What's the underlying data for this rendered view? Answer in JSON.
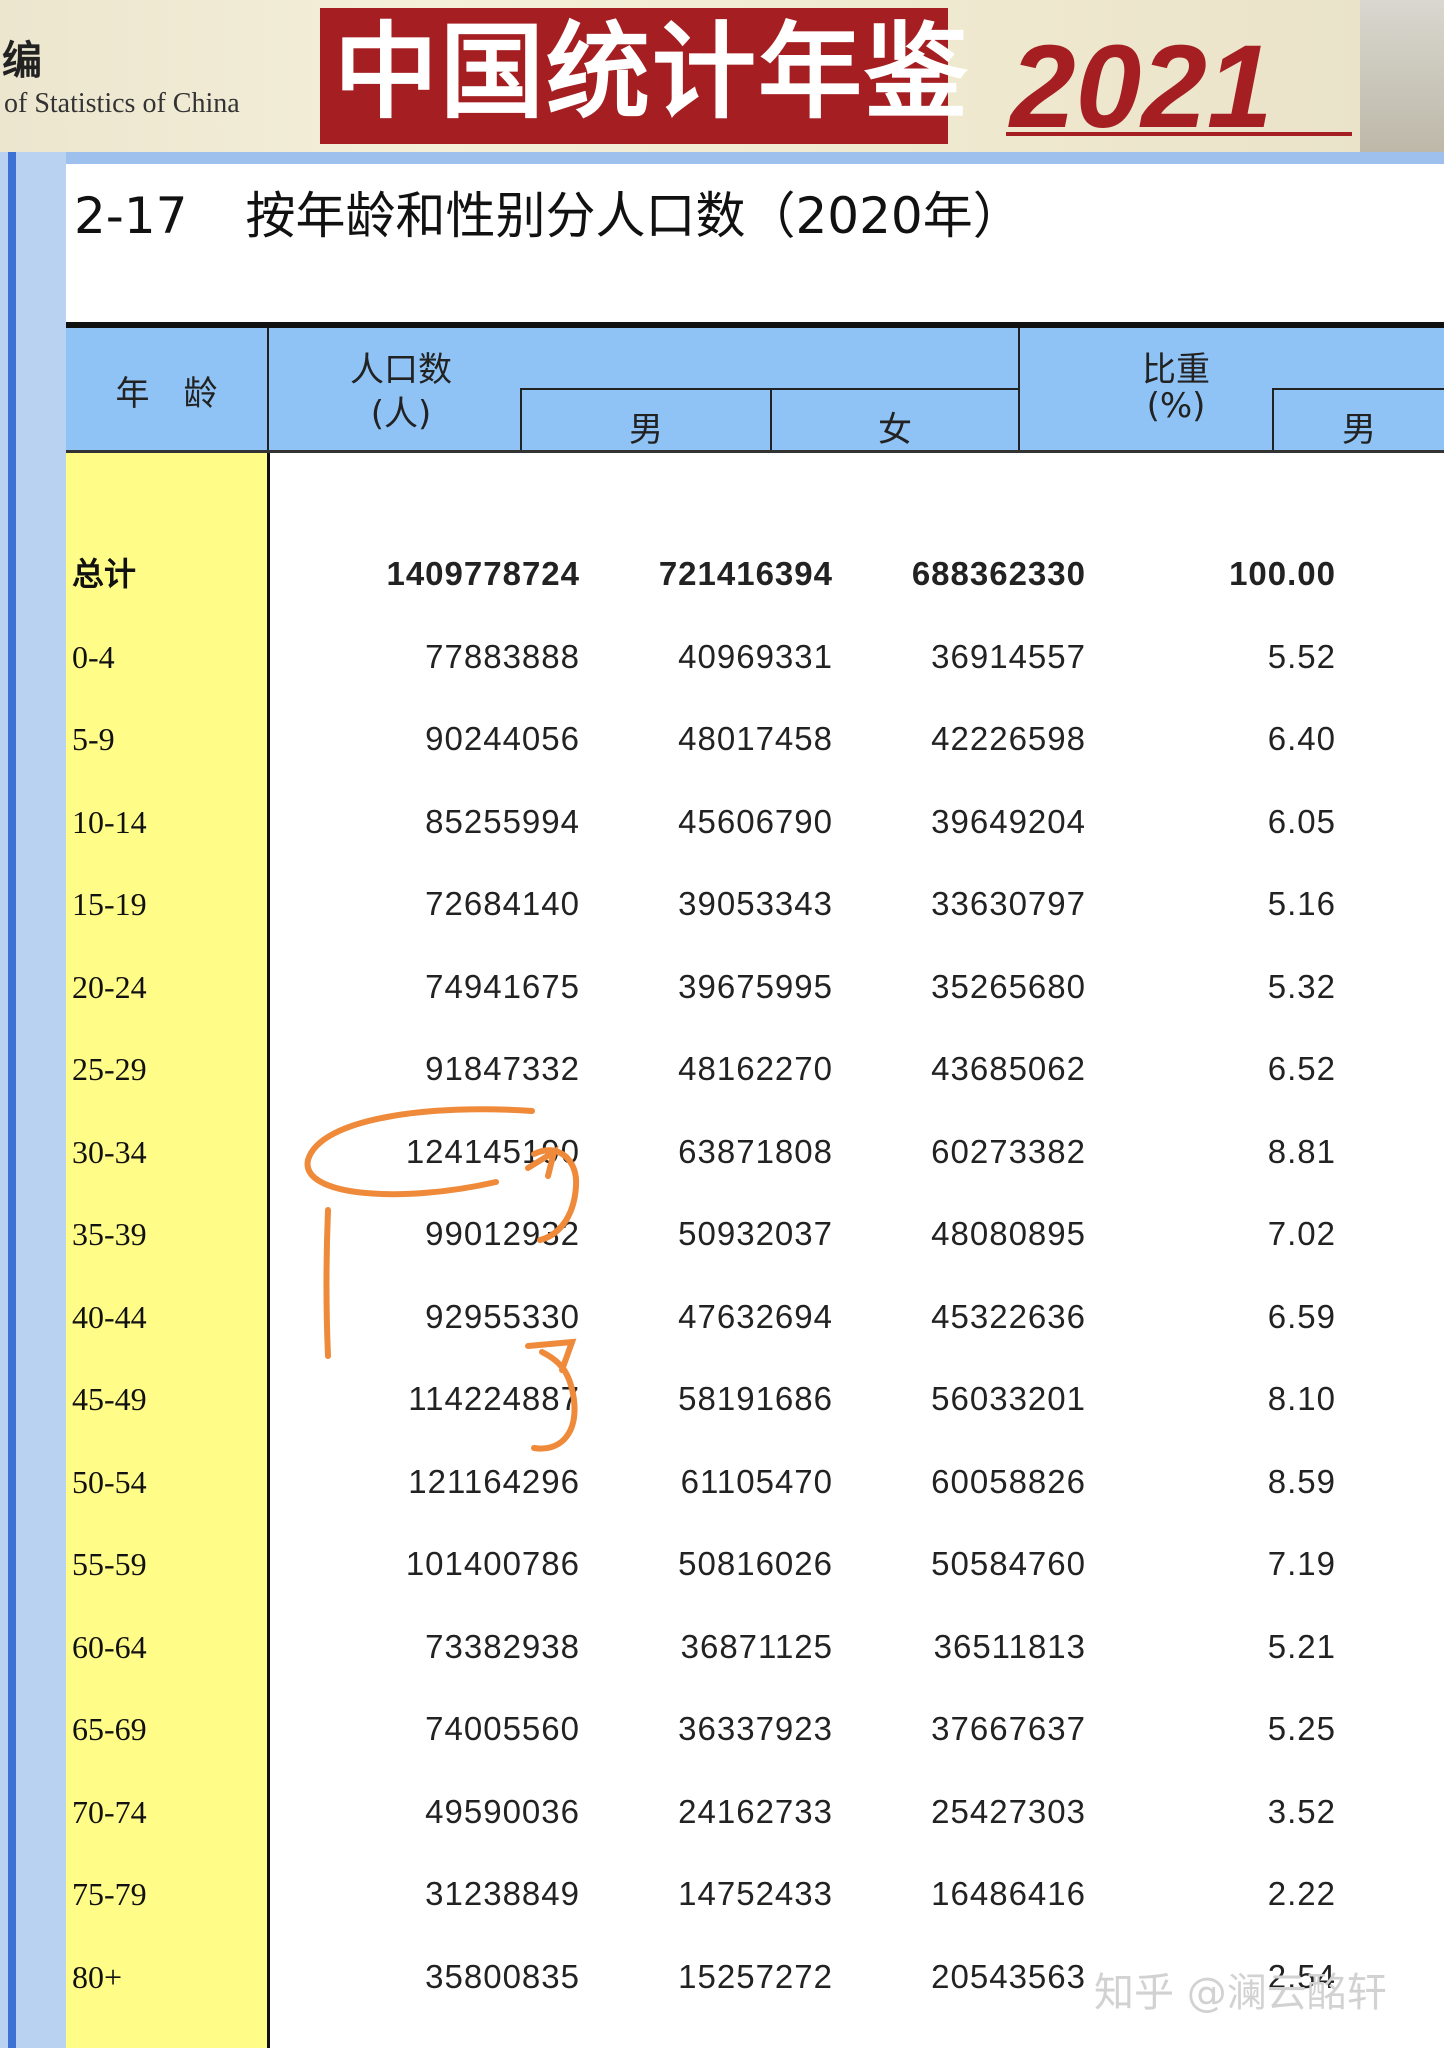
{
  "banner": {
    "edit_char": "编",
    "english_partial": "of Statistics of China",
    "title": "中国统计年鉴",
    "year": "2021"
  },
  "table": {
    "number": "2-17",
    "title": "按年龄和性别分人口数（2020年）",
    "headers": {
      "age": "年　龄",
      "population": "人口数",
      "population_unit": "(人)",
      "male": "男",
      "female": "女",
      "share": "比重",
      "share_unit": "(%)",
      "share_male": "男"
    },
    "total_row": {
      "label": "总计",
      "population": "1409778724",
      "male": "721416394",
      "female": "688362330",
      "share": "100.00"
    },
    "rows": [
      {
        "age": "0-4",
        "population": "77883888",
        "male": "40969331",
        "female": "36914557",
        "share": "5.52"
      },
      {
        "age": "5-9",
        "population": "90244056",
        "male": "48017458",
        "female": "42226598",
        "share": "6.40"
      },
      {
        "age": "10-14",
        "population": "85255994",
        "male": "45606790",
        "female": "39649204",
        "share": "6.05"
      },
      {
        "age": "15-19",
        "population": "72684140",
        "male": "39053343",
        "female": "33630797",
        "share": "5.16"
      },
      {
        "age": "20-24",
        "population": "74941675",
        "male": "39675995",
        "female": "35265680",
        "share": "5.32"
      },
      {
        "age": "25-29",
        "population": "91847332",
        "male": "48162270",
        "female": "43685062",
        "share": "6.52"
      },
      {
        "age": "30-34",
        "population": "124145190",
        "male": "63871808",
        "female": "60273382",
        "share": "8.81"
      },
      {
        "age": "35-39",
        "population": "99012932",
        "male": "50932037",
        "female": "48080895",
        "share": "7.02"
      },
      {
        "age": "40-44",
        "population": "92955330",
        "male": "47632694",
        "female": "45322636",
        "share": "6.59"
      },
      {
        "age": "45-49",
        "population": "114224887",
        "male": "58191686",
        "female": "56033201",
        "share": "8.10"
      },
      {
        "age": "50-54",
        "population": "121164296",
        "male": "61105470",
        "female": "60058826",
        "share": "8.59"
      },
      {
        "age": "55-59",
        "population": "101400786",
        "male": "50816026",
        "female": "50584760",
        "share": "7.19"
      },
      {
        "age": "60-64",
        "population": "73382938",
        "male": "36871125",
        "female": "36511813",
        "share": "5.21"
      },
      {
        "age": "65-69",
        "population": "74005560",
        "male": "36337923",
        "female": "37667637",
        "share": "5.25"
      },
      {
        "age": "70-74",
        "population": "49590036",
        "male": "24162733",
        "female": "25427303",
        "share": "3.52"
      },
      {
        "age": "75-79",
        "population": "31238849",
        "male": "14752433",
        "female": "16486416",
        "share": "2.22"
      },
      {
        "age": "80+",
        "population": "35800835",
        "male": "15257272",
        "female": "20543563",
        "share": "2.54"
      }
    ]
  },
  "watermark": "知乎 @澜云酩轩",
  "colors": {
    "header_blue": "#8fc3f5",
    "age_yellow": "#fffd88",
    "brand_red": "#a51f22",
    "annotation_orange": "#ee8a3a"
  }
}
